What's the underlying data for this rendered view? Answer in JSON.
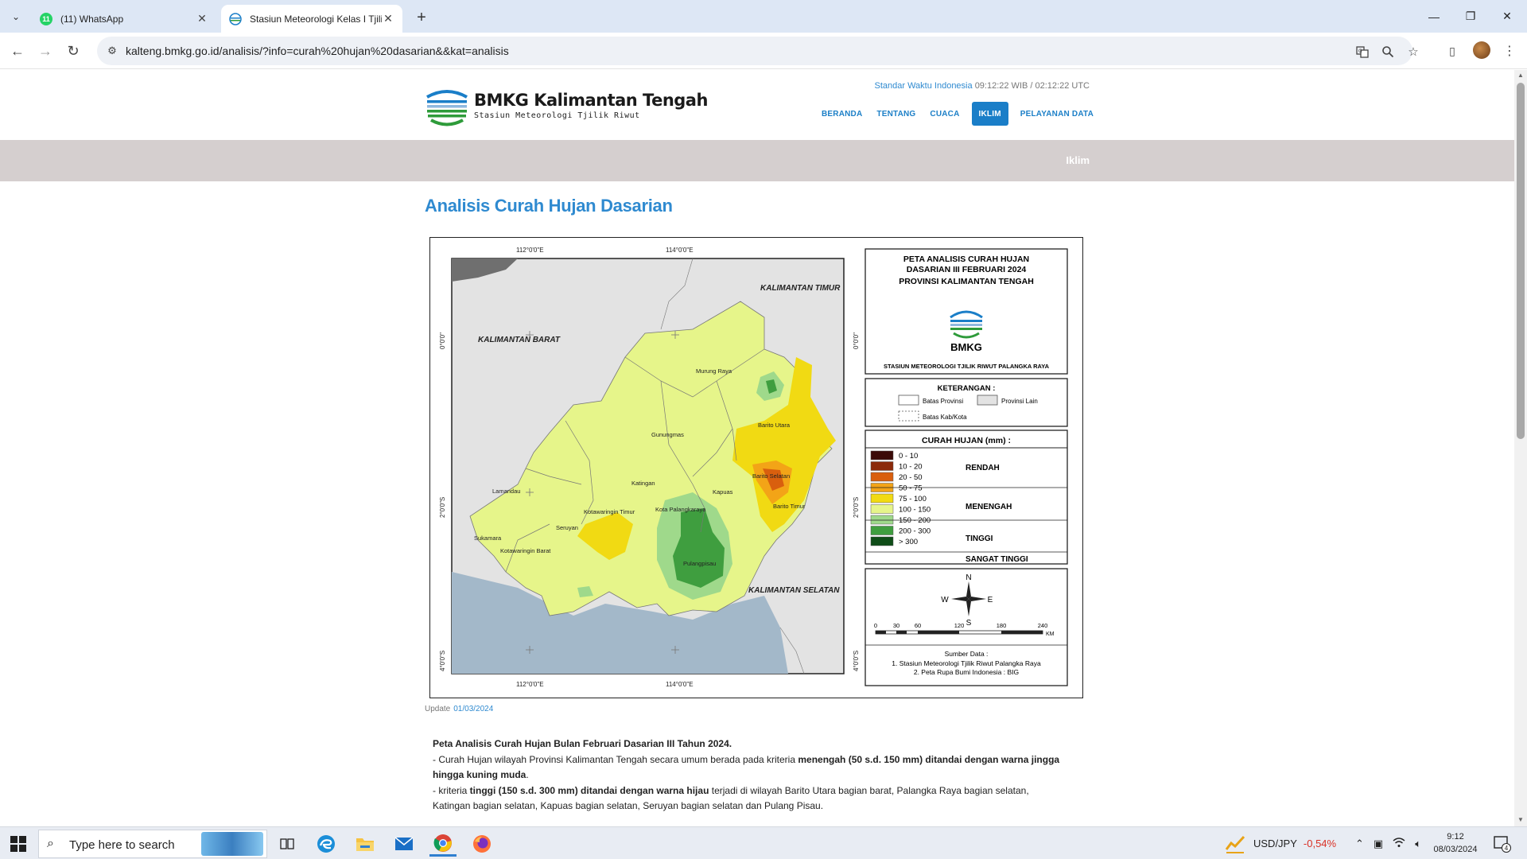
{
  "browser": {
    "tabs": [
      {
        "title": "(11) WhatsApp",
        "badge": "11",
        "active": false
      },
      {
        "title": "Stasiun Meteorologi Kelas I Tjilik",
        "active": true
      }
    ],
    "url": "kalteng.bmkg.go.id/analisis/?info=curah%20hujan%20dasarian&&kat=analisis"
  },
  "site": {
    "logo_title": "BMKG Kalimantan Tengah",
    "logo_subtitle": "Stasiun Meteorologi Tjilik Riwut",
    "time_label": "Standar Waktu Indonesia",
    "time_value": "09:12:22 WIB / 02:12:22 UTC",
    "nav": [
      "BERANDA",
      "TENTANG",
      "CUACA",
      "IKLIM",
      "PELAYANAN DATA"
    ],
    "nav_active": "IKLIM",
    "banner_label": "Iklim",
    "page_title": "Analisis Curah Hujan Dasarian",
    "update_label": "Update",
    "update_date": "01/03/2024"
  },
  "map": {
    "title_lines": [
      "PETA ANALISIS CURAH HUJAN",
      "DASARIAN III FEBRUARI 2024",
      "PROVINSI KALIMANTAN TENGAH"
    ],
    "agency": "BMKG",
    "station": "STASIUN METEOROLOGI TJILIK RIWUT PALANGKA RAYA",
    "keterangan_title": "KETERANGAN :",
    "legend_keys": [
      "Batas Provinsi",
      "Provinsi Lain",
      "Batas Kab/Kota"
    ],
    "ch_title": "CURAH HUJAN (mm) :",
    "classes": [
      {
        "range": "0 - 10",
        "color": "#3b0a08"
      },
      {
        "range": "10 - 20",
        "color": "#8b2a0a"
      },
      {
        "range": "20 - 50",
        "color": "#d95f0e"
      },
      {
        "range": "50 - 75",
        "color": "#f3a417"
      },
      {
        "range": "75 - 100",
        "color": "#f1da13"
      },
      {
        "range": "100 - 150",
        "color": "#e6f58a"
      },
      {
        "range": "150 - 200",
        "color": "#9fd98b"
      },
      {
        "range": "200 - 300",
        "color": "#3f9e3f"
      },
      {
        "range": "> 300",
        "color": "#0f4d18"
      }
    ],
    "groups": [
      "RENDAH",
      "MENENGAH",
      "TINGGI",
      "SANGAT TINGGI"
    ],
    "compass": {
      "n": "N",
      "s": "S",
      "e": "E",
      "w": "W"
    },
    "scale_ticks": [
      "0",
      "30",
      "60",
      "120",
      "180",
      "240"
    ],
    "scale_unit": "KM",
    "source_title": "Sumber Data :",
    "source_lines": [
      "1. Stasiun Meteorologi Tjilik Riwut Palangka Raya",
      "2. Peta Rupa Bumi Indonesia : BIG"
    ],
    "lon_labels": [
      "112°0'0\"E",
      "114°0'0\"E"
    ],
    "lat_labels": [
      "0°0'0\"",
      "2°0'0\"S",
      "4°0'0\"S"
    ],
    "regions": {
      "kalbar": "KALIMANTAN BARAT",
      "kaltim": "KALIMANTAN TIMUR",
      "kalsel": "KALIMANTAN SELATAN"
    },
    "districts": [
      "Murung Raya",
      "Barito Utara",
      "Gunungmas",
      "Katingan",
      "Kapuas",
      "Barito Selatan",
      "Barito Timur",
      "Lamandau",
      "Kotawaringin Timur",
      "Kota Palangkaraya",
      "Seruyan",
      "Sukamara",
      "Kotawaringin Barat",
      "Pulangpisau"
    ]
  },
  "description": {
    "heading": "Peta Analisis Curah Hujan Bulan Februari Dasarian III Tahun 2024.",
    "p1_a": "- Curah Hujan wilayah Provinsi Kalimantan Tengah secara umum berada pada kriteria ",
    "p1_b": "menengah (50 s.d. 150 mm) ditandai dengan warna jingga hingga kuning muda",
    "p1_c": ".",
    "p2_a": "- kriteria ",
    "p2_b": "tinggi (150 s.d. 300 mm) ditandai dengan warna hijau",
    "p2_c": " terjadi di wilayah  Barito Utara bagian barat, Palangka Raya bagian selatan, Katingan bagian selatan, Kapuas bagian selatan, Seruyan bagian selatan dan Pulang Pisau."
  },
  "taskbar": {
    "search_placeholder": "Type here to search",
    "ticker_label": "USD/JPY",
    "ticker_value": "-0,54%",
    "time": "9:12",
    "date": "08/03/2024",
    "notif_count": "4"
  }
}
